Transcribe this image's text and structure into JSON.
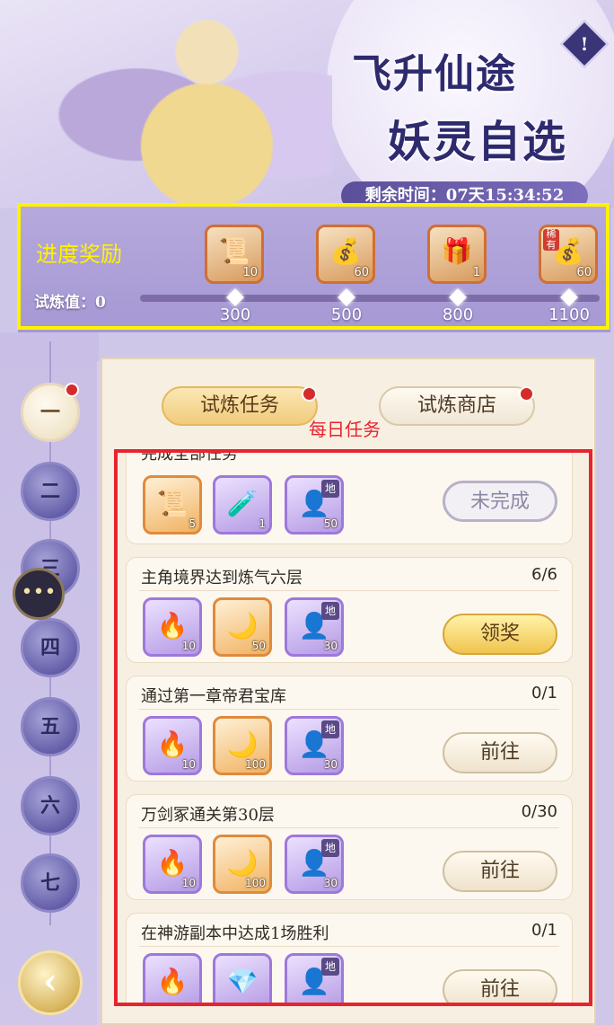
{
  "banner": {
    "title_line1": "飞升仙途",
    "title_line2": "妖灵自选",
    "info_icon": "!",
    "timer_label": "剩余时间：",
    "timer_value": "07天15:34:52"
  },
  "progress": {
    "heading": "进度奖励",
    "trial_label": "试炼值：",
    "trial_value": "0",
    "milestones": [
      "300",
      "500",
      "800",
      "1100"
    ],
    "rewards": [
      {
        "icon": "scroll-token-icon",
        "count": "10"
      },
      {
        "icon": "lucky-bag-icon",
        "count": "60"
      },
      {
        "icon": "treasure-chest-icon",
        "count": "1"
      },
      {
        "icon": "rare-lucky-bag-icon",
        "count": "60",
        "tag": "稀有"
      }
    ]
  },
  "chapters": [
    "一",
    "二",
    "三",
    "四",
    "五",
    "六",
    "七"
  ],
  "tabs": {
    "trial_tasks": "试炼任务",
    "trial_shop": "试炼商店"
  },
  "daily_label": "每日任务",
  "tasks": [
    {
      "title": "完成全部任务",
      "progress": "",
      "rewards": [
        {
          "icon": "scroll-token-icon",
          "count": "5",
          "frame": "orange"
        },
        {
          "icon": "potion-bottle-icon",
          "count": "1",
          "frame": "purple"
        },
        {
          "icon": "character-portrait-icon",
          "count": "50",
          "frame": "purple",
          "grade": "地"
        }
      ],
      "action": "未完成",
      "state": "disabled"
    },
    {
      "title": "主角境界达到炼气六层",
      "progress": "6/6",
      "rewards": [
        {
          "icon": "flame-icon",
          "count": "10",
          "frame": "purple"
        },
        {
          "icon": "spirit-flame-icon",
          "count": "50",
          "frame": "orange"
        },
        {
          "icon": "character-portrait-icon",
          "count": "30",
          "frame": "purple",
          "grade": "地"
        }
      ],
      "action": "领奖",
      "state": "claim"
    },
    {
      "title": "通过第一章帝君宝库",
      "progress": "0/1",
      "rewards": [
        {
          "icon": "flame-icon",
          "count": "10",
          "frame": "purple"
        },
        {
          "icon": "spirit-flame-icon",
          "count": "100",
          "frame": "orange"
        },
        {
          "icon": "character-portrait-icon",
          "count": "30",
          "frame": "purple",
          "grade": "地"
        }
      ],
      "action": "前往",
      "state": "go"
    },
    {
      "title": "万剑冢通关第30层",
      "progress": "0/30",
      "rewards": [
        {
          "icon": "flame-icon",
          "count": "10",
          "frame": "purple"
        },
        {
          "icon": "spirit-flame-icon",
          "count": "100",
          "frame": "orange"
        },
        {
          "icon": "character-portrait-icon",
          "count": "30",
          "frame": "purple",
          "grade": "地"
        }
      ],
      "action": "前往",
      "state": "go"
    },
    {
      "title": "在神游副本中达成1场胜利",
      "progress": "0/1",
      "rewards": [
        {
          "icon": "flame-icon",
          "count": "",
          "frame": "purple"
        },
        {
          "icon": "crystal-shard-icon",
          "count": "",
          "frame": "purple"
        },
        {
          "icon": "character-portrait-icon",
          "count": "",
          "frame": "purple",
          "grade": "地"
        }
      ],
      "action": "前往",
      "state": "go"
    }
  ],
  "colors": {
    "annotation_yellow": "#fff200",
    "annotation_red": "#e8232f",
    "accent_purple": "#3a3577",
    "claim_gold": "#f0c44e"
  }
}
